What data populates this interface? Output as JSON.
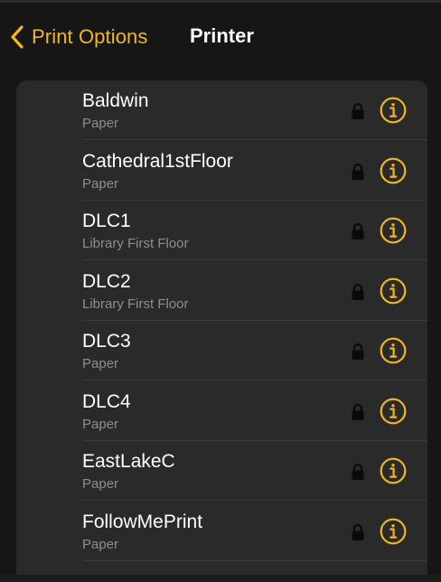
{
  "navbar": {
    "back_label": "Print Options",
    "title": "Printer"
  },
  "colors": {
    "accent": "#f2b61f",
    "background": "#161616",
    "cell": "#2a2a2a",
    "subtitle": "#8e8e8e"
  },
  "icons": {
    "back": "chevron-left-icon",
    "lock": "lock-icon",
    "info": "info-circle-icon"
  },
  "printers": [
    {
      "name": "Baldwin",
      "subtitle": "Paper"
    },
    {
      "name": "Cathedral1stFloor",
      "subtitle": "Paper"
    },
    {
      "name": "DLC1",
      "subtitle": "Library First Floor"
    },
    {
      "name": "DLC2",
      "subtitle": "Library First Floor"
    },
    {
      "name": "DLC3",
      "subtitle": "Paper"
    },
    {
      "name": "DLC4",
      "subtitle": "Paper"
    },
    {
      "name": "EastLakeC",
      "subtitle": "Paper"
    },
    {
      "name": "FollowMePrint",
      "subtitle": "Paper"
    }
  ]
}
